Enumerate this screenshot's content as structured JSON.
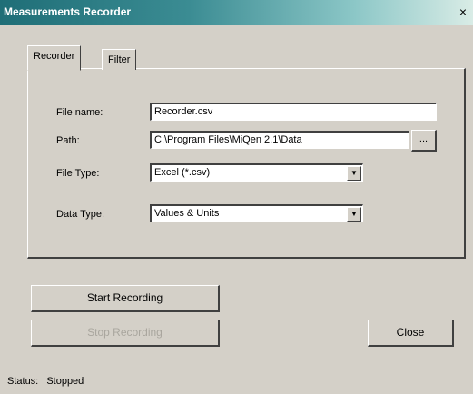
{
  "window": {
    "title": "Measurements Recorder",
    "close_glyph": "×"
  },
  "tabs": [
    {
      "label": "Recorder",
      "active": true
    },
    {
      "label": "Filter",
      "active": false
    }
  ],
  "form": {
    "file_name_label": "File name:",
    "file_name_value": "Recorder.csv",
    "path_label": "Path:",
    "path_value": "C:\\Program Files\\MiQen 2.1\\Data",
    "browse_label": "...",
    "file_type_label": "File Type:",
    "file_type_value": "Excel (*.csv)",
    "data_type_label": "Data Type:",
    "data_type_value": "Values & Units",
    "dropdown_glyph": "▼"
  },
  "buttons": {
    "start": "Start Recording",
    "stop": "Stop Recording",
    "close": "Close"
  },
  "status": {
    "label": "Status:",
    "value": "Stopped"
  }
}
